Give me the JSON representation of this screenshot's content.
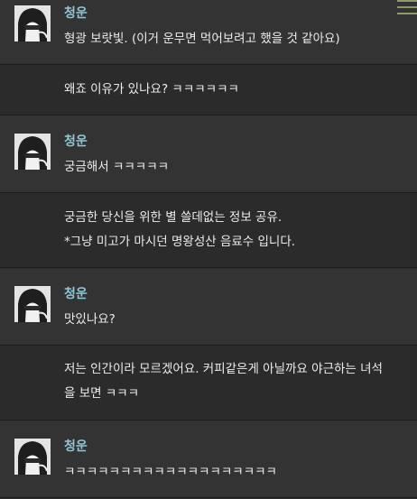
{
  "menu_icon": "hamburger-menu-icon",
  "accent_name_color": "#8fc7d6",
  "messages": [
    {
      "speaker": "청운",
      "text": "형광 보랏빛. (이거 운무면 먹어보려고 했을 것 같아요)"
    },
    {
      "text": "왜죠 이유가 있나요? ㅋㅋㅋㅋㅋㅋ"
    },
    {
      "speaker": "청운",
      "text": "궁금해서 ㅋㅋㅋㅋㅋ"
    },
    {
      "text_lines": [
        "궁금한 당신을 위한 별 쓸데없는 정보 공유.",
        "*그냥 미고가 마시던 명왕성산 음료수 입니다."
      ]
    },
    {
      "speaker": "청운",
      "text": "맛있나요?"
    },
    {
      "text_lines": [
        "저는 인간이라 모르겠어요. 커피같은게 아닐까요 야근하는 녀석",
        "을 보면 ㅋㅋㅋ"
      ]
    },
    {
      "speaker": "청운",
      "text": "ㅋㅋㅋㅋㅋㅋㅋㅋㅋㅋㅋㅋㅋㅋㅋㅋㅋㅋㅋ"
    }
  ]
}
